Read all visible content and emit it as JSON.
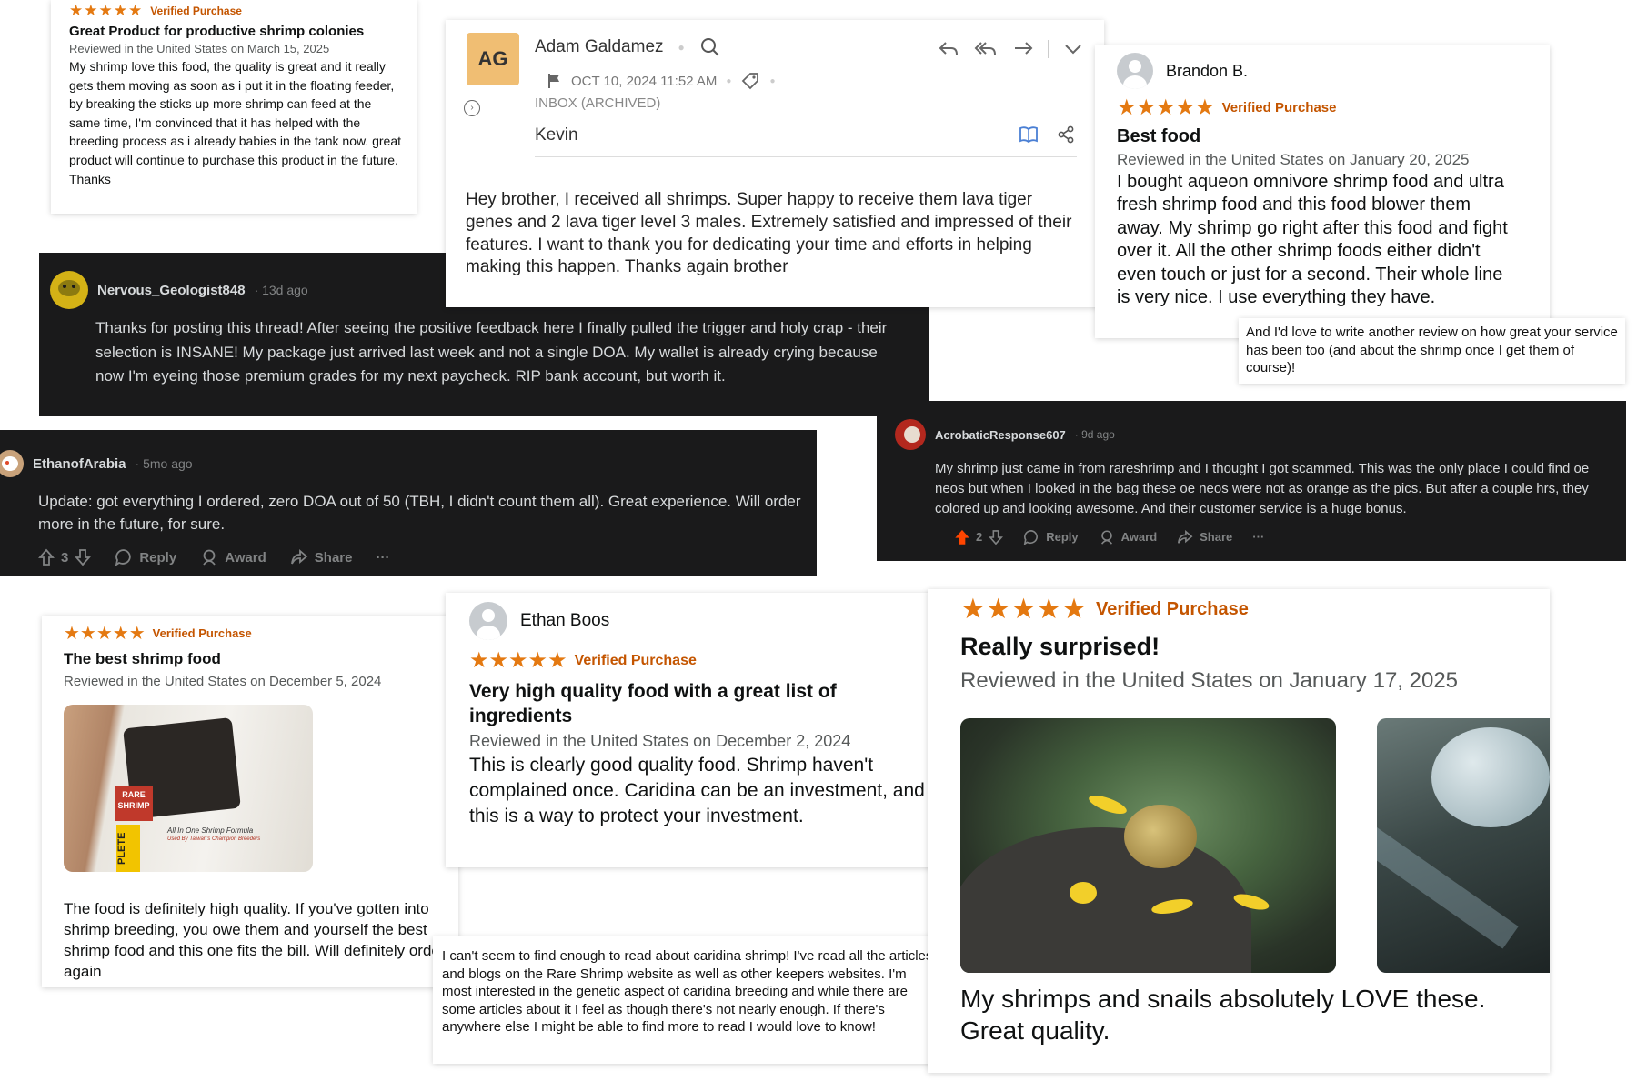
{
  "r1": {
    "stars": "★★★★★",
    "verified": "Verified Purchase",
    "title": "Great Product for productive shrimp colonies",
    "meta": "Reviewed in the United States on March 15, 2025",
    "body": "My shrimp love this food, the quality is great and it really gets them moving as soon as i put it in the floating feeder, by breaking the sticks up more shrimp can feed at the same time, I'm convinced that it has helped with the breeding process as i already babies in the tank now. great product will continue to purchase this product in the future. Thanks"
  },
  "email": {
    "initials": "AG",
    "sender": "Adam Galdamez",
    "date": "OCT 10, 2024 11:52 AM",
    "folder": "INBOX (ARCHIVED)",
    "recipient": "Kevin",
    "body": "Hey brother, I received all shrimps. Super happy to receive them lava tiger genes and 2 lava tiger level 3 males. Extremely satisfied and impressed of their features. I want to thank you for dedicating your time and efforts in helping making this happen. Thanks again brother",
    "accent": "#f0be73"
  },
  "r2": {
    "name": "Brandon B.",
    "stars": "★★★★★",
    "verified": "Verified Purchase",
    "title": "Best food",
    "meta": "Reviewed in the United States on January 20, 2025",
    "body": "I bought aqueon omnivore shrimp food and ultra fresh shrimp food and this food blower them away. My shrimp go right after this food and fight over it. All the other shrimp foods either didn't even touch or just for a second. Their whole line is very nice. I use everything they have."
  },
  "note1": {
    "text": "And I'd love to write another review on how great your service has been too (and about the shrimp once I get them of course)!"
  },
  "reddit1": {
    "user": "Nervous_Geologist848",
    "time": "· 13d ago",
    "body": "Thanks for posting this thread! After seeing the positive feedback here I finally pulled the trigger and holy crap - their selection is INSANE! My package just arrived last week and not a single DOA. My wallet is already crying because now I'm eyeing those premium grades for my next paycheck. RIP bank account, but worth it."
  },
  "reddit2": {
    "user": "EthanofArabia",
    "time": "· 5mo ago",
    "body": "Update: got everything I ordered, zero DOA out of 50 (TBH, I didn't count them all). Great experience. Will order more in the future, for sure.",
    "votes": "3",
    "reply": "Reply",
    "award": "Award",
    "share": "Share",
    "more": "···"
  },
  "reddit3": {
    "user": "AcrobaticResponse607",
    "time": "· 9d ago",
    "body": "My shrimp just came in from rareshrimp and I thought I got scammed. This was the only place I could find oe neos but when I looked in the bag these oe neos were not as orange as the pics. But after a couple hrs, they colored up and looking awesome. And their customer service is a huge bonus.",
    "votes": "2",
    "reply": "Reply",
    "award": "Award",
    "share": "Share",
    "more": "···",
    "upvote_color": "#ff4500"
  },
  "r3": {
    "stars": "★★★★★",
    "verified": "Verified Purchase",
    "title": "The best shrimp food",
    "meta": "Reviewed in the United States on December 5, 2024",
    "body": "The food is definitely high quality. If you've gotten into shrimp breeding, you owe them and yourself the best shrimp food and this one fits the bill. Will definitely order again",
    "bag_text": "All In One Shrimp Formula",
    "bag_subtext": "Used By Taiwan's Champion Breeders",
    "bag_logo": "RARE SHRIMP",
    "bag_side": "PLETE"
  },
  "r4": {
    "name": "Ethan Boos",
    "stars": "★★★★★",
    "verified": "Verified Purchase",
    "title": "Very high quality food with a great list of ingredients",
    "meta": "Reviewed in the United States on December 2, 2024",
    "body": "This is clearly good quality food. Shrimp haven't complained once. Caridina can be an investment, and this is a way to protect your investment."
  },
  "note2": {
    "text": "I can't seem to find enough to read about caridina shrimp! I've read all the articles and blogs on the Rare Shrimp website as well as other keepers websites. I'm most interested in the genetic aspect of caridina breeding and while there are some articles about it I feel as though there's not nearly enough. If there's anywhere else I might be able to find more to read I would love to know!"
  },
  "r5": {
    "stars": "★★★★★",
    "verified": "Verified Purchase",
    "title": "Really surprised!",
    "meta": "Reviewed in the United States on January 17, 2025",
    "body": "My shrimps and snails absolutely LOVE these. Great quality."
  }
}
